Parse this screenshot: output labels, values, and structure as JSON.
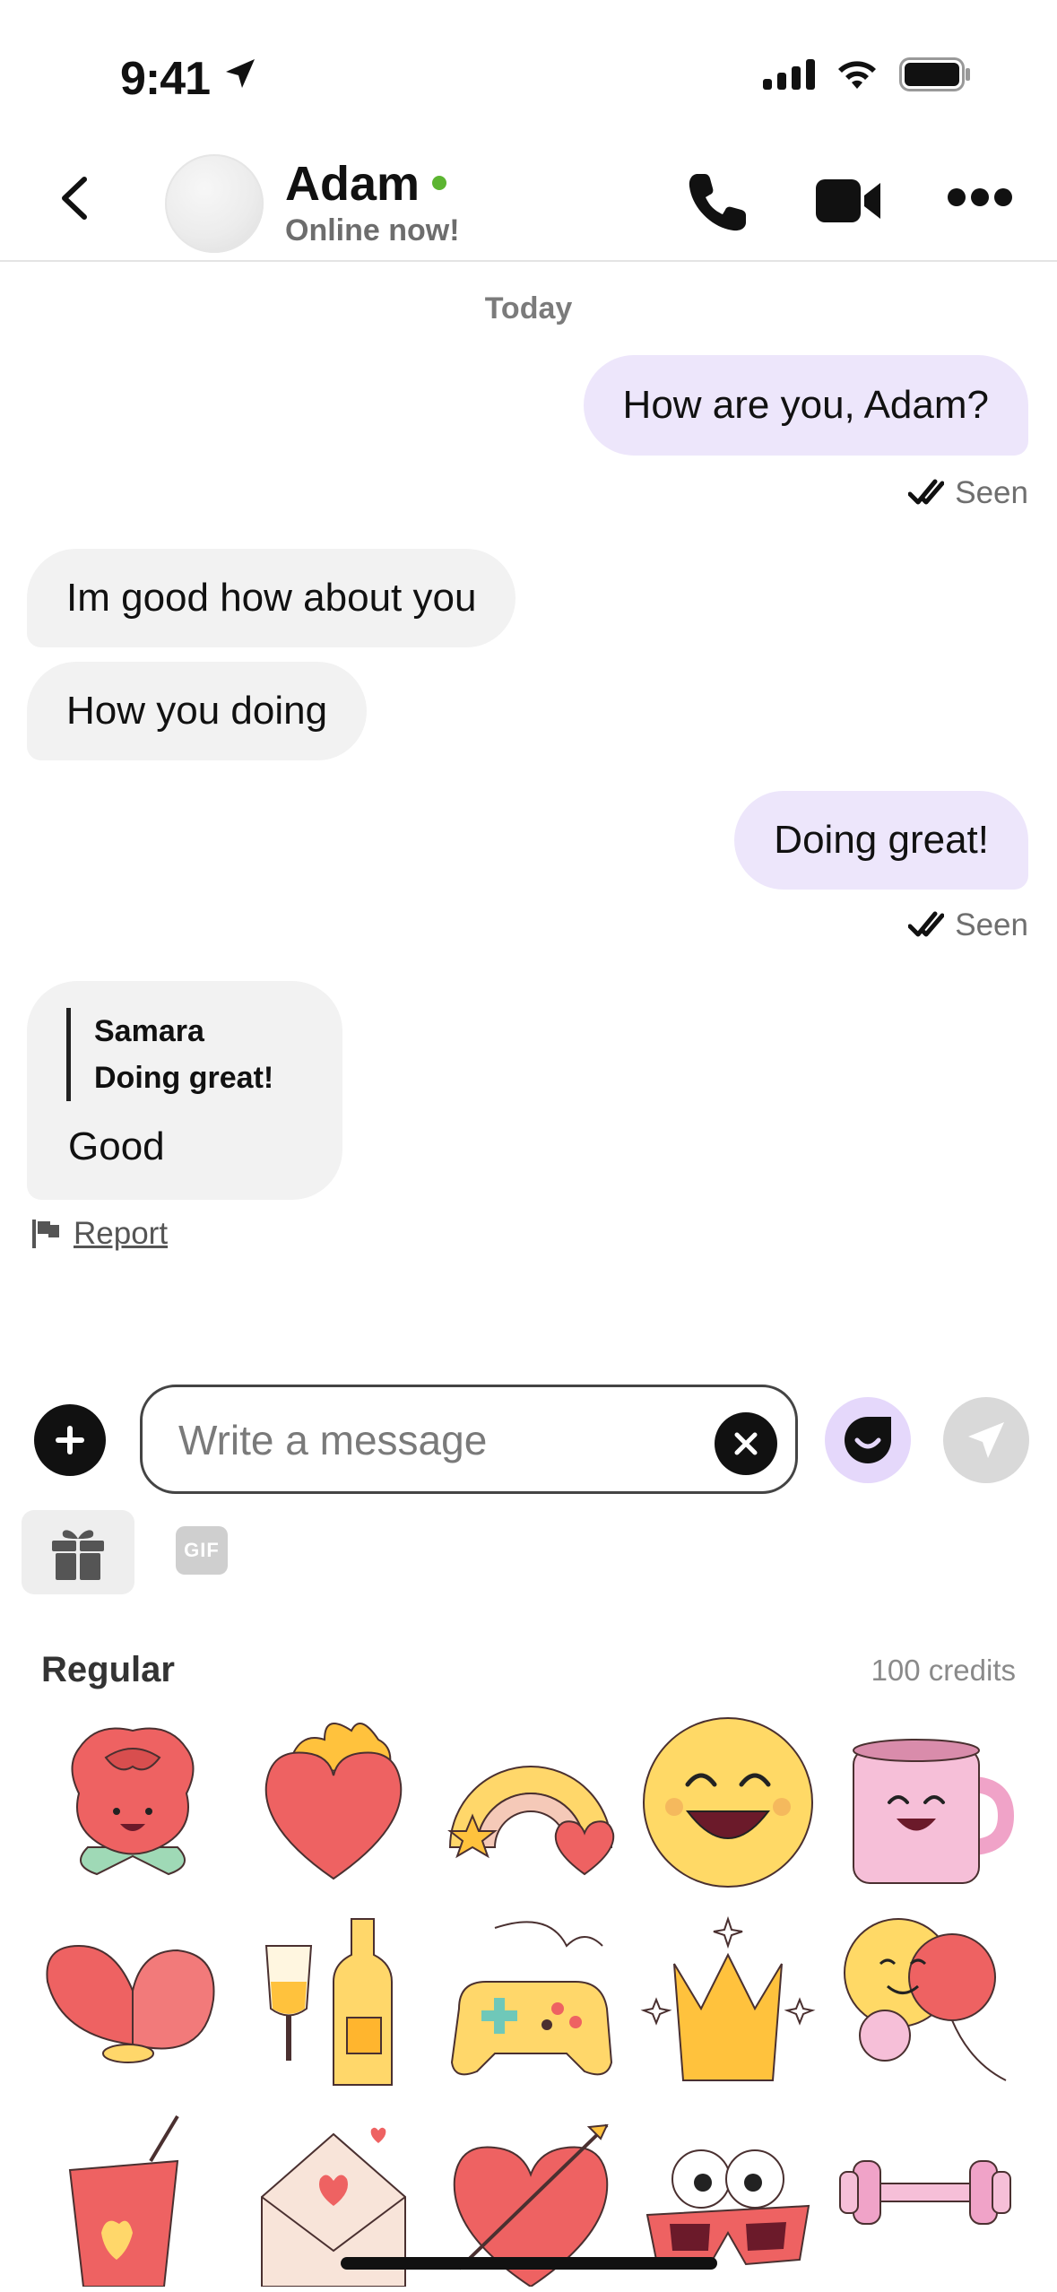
{
  "status_bar": {
    "time": "9:41"
  },
  "header": {
    "name": "Adam",
    "status": "Online now!",
    "icons": [
      "back-icon",
      "phone-icon",
      "video-icon",
      "more-icon"
    ]
  },
  "chat": {
    "date_label": "Today",
    "messages": [
      {
        "direction": "out",
        "text": "How are you, Adam?",
        "receipt": "Seen"
      },
      {
        "direction": "in",
        "text": "Im good how about you"
      },
      {
        "direction": "in",
        "text": "How you doing"
      },
      {
        "direction": "out",
        "text": "Doing great!",
        "receipt": "Seen"
      },
      {
        "direction": "in",
        "text": "Good",
        "quote": {
          "name": "Samara",
          "text": "Doing great!"
        }
      }
    ],
    "report_label": "Report"
  },
  "composer": {
    "placeholder": "Write a message",
    "value": ""
  },
  "tools": {
    "gif_label": "GIF"
  },
  "stickers": {
    "section_title": "Regular",
    "credits": "100 credits",
    "items": [
      "rose",
      "flaming-heart",
      "rainbow",
      "smiley",
      "mug",
      "butterfly-heart",
      "champagne",
      "game-controller",
      "crown",
      "balloons",
      "drink-cup",
      "love-letter",
      "arrow-heart",
      "party-glasses",
      "dumbbell"
    ]
  },
  "colors": {
    "accent_light": "#ede6fb",
    "incoming": "#f2f2f2",
    "online": "#5cb531"
  }
}
